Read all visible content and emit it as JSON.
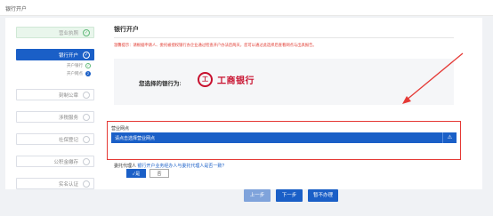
{
  "header": {
    "title": "银行开户"
  },
  "sidebar": {
    "steps": [
      {
        "label": "营业执照",
        "icon": "check",
        "state": "done"
      },
      {
        "label": "银行开户",
        "icon": "check",
        "state": "active"
      },
      {
        "label": "刻制公章",
        "icon": "circle",
        "state": "pending"
      },
      {
        "label": "涉税服务",
        "icon": "circle",
        "state": "pending"
      },
      {
        "label": "社保登记",
        "icon": "circle",
        "state": "pending"
      },
      {
        "label": "公积金缴存",
        "icon": "circle",
        "state": "pending"
      },
      {
        "label": "实名认证",
        "icon": "circle",
        "state": "pending"
      }
    ],
    "substeps": [
      {
        "label": "开户银行",
        "badge": "✓"
      },
      {
        "label": "开户网点",
        "badge": "2"
      }
    ]
  },
  "main": {
    "section_title": "银行开户",
    "warning": "温馨提示：请根据申请人、委托被授权银行办企业通过检查开户办法后两天，您可以通过此选择后查看网点与出具报告。",
    "bank_question": "您选择的银行为:",
    "bank_mark": "工",
    "bank_name": "工商银行",
    "branch": {
      "label": "营业网点",
      "placeholder": "请点击选择营业网点"
    },
    "delegate": {
      "question_prefix": "委托代理人",
      "question_body": "银行开户业务经办人与委托代理人是否一致?"
    },
    "radio": {
      "yes": "是",
      "no": "否"
    },
    "actions": {
      "prev": "上一步",
      "next": "下一步",
      "skip": "暂不办理"
    }
  },
  "colors": {
    "primary": "#1a5fc7",
    "brand_red": "#c8102e",
    "highlight_red": "#e53935",
    "done_green": "#5fb878"
  }
}
